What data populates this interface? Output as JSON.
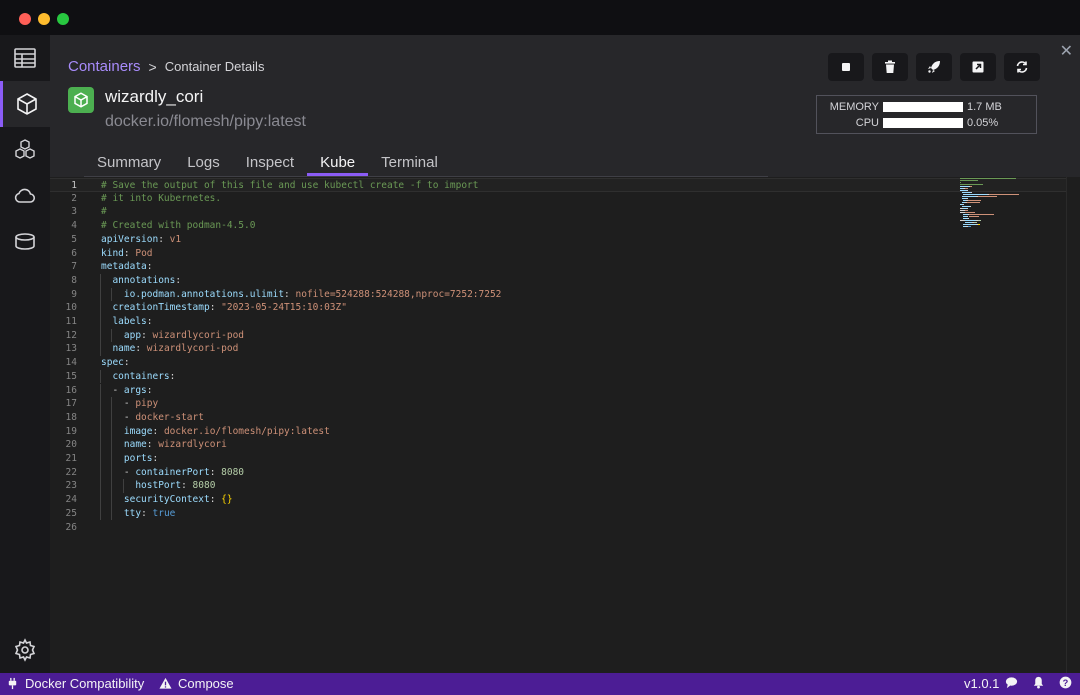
{
  "breadcrumb": {
    "parent": "Containers",
    "separator": ">",
    "current": "Container Details"
  },
  "container": {
    "name": "wizardly_cori",
    "image": "docker.io/flomesh/pipy:latest"
  },
  "actions": [
    {
      "id": "stop",
      "icon": "stop-icon"
    },
    {
      "id": "delete",
      "icon": "trash-icon"
    },
    {
      "id": "deploy",
      "icon": "rocket-icon"
    },
    {
      "id": "open-browser",
      "icon": "external-link-icon"
    },
    {
      "id": "restart",
      "icon": "refresh-icon"
    }
  ],
  "stats": {
    "memory": {
      "label": "MEMORY",
      "value": "1.7 MB",
      "fill": 0.98
    },
    "cpu": {
      "label": "CPU",
      "value": "0.05%",
      "fill": 0.98
    }
  },
  "tabs": [
    "Summary",
    "Logs",
    "Inspect",
    "Kube",
    "Terminal"
  ],
  "active_tab": "Kube",
  "editor": {
    "current_line": 1,
    "lines": [
      [
        [
          "c-com",
          "# Save the output of this file and use kubectl create -f to import"
        ]
      ],
      [
        [
          "c-com",
          "# it into Kubernetes."
        ]
      ],
      [
        [
          "c-com",
          "#"
        ]
      ],
      [
        [
          "c-com",
          "# Created with podman-4.5.0"
        ]
      ],
      [
        [
          "c-key",
          "apiVersion"
        ],
        [
          "c-pun",
          ": "
        ],
        [
          "c-str",
          "v1"
        ]
      ],
      [
        [
          "c-key",
          "kind"
        ],
        [
          "c-pun",
          ": "
        ],
        [
          "c-str",
          "Pod"
        ]
      ],
      [
        [
          "c-key",
          "metadata"
        ],
        [
          "c-pun",
          ":"
        ]
      ],
      [
        [
          "c-pun",
          "  "
        ],
        [
          "c-key",
          "annotations"
        ],
        [
          "c-pun",
          ":"
        ]
      ],
      [
        [
          "c-pun",
          "    "
        ],
        [
          "c-key",
          "io.podman.annotations.ulimit"
        ],
        [
          "c-pun",
          ": "
        ],
        [
          "c-str",
          "nofile=524288:524288,nproc=7252:7252"
        ]
      ],
      [
        [
          "c-pun",
          "  "
        ],
        [
          "c-key",
          "creationTimestamp"
        ],
        [
          "c-pun",
          ": "
        ],
        [
          "c-str",
          "\"2023-05-24T15:10:03Z\""
        ]
      ],
      [
        [
          "c-pun",
          "  "
        ],
        [
          "c-key",
          "labels"
        ],
        [
          "c-pun",
          ":"
        ]
      ],
      [
        [
          "c-pun",
          "    "
        ],
        [
          "c-key",
          "app"
        ],
        [
          "c-pun",
          ": "
        ],
        [
          "c-str",
          "wizardlycori-pod"
        ]
      ],
      [
        [
          "c-pun",
          "  "
        ],
        [
          "c-key",
          "name"
        ],
        [
          "c-pun",
          ": "
        ],
        [
          "c-str",
          "wizardlycori-pod"
        ]
      ],
      [
        [
          "c-key",
          "spec"
        ],
        [
          "c-pun",
          ":"
        ]
      ],
      [
        [
          "c-pun",
          "  "
        ],
        [
          "c-key",
          "containers"
        ],
        [
          "c-pun",
          ":"
        ]
      ],
      [
        [
          "c-pun",
          "  - "
        ],
        [
          "c-key",
          "args"
        ],
        [
          "c-pun",
          ":"
        ]
      ],
      [
        [
          "c-pun",
          "    - "
        ],
        [
          "c-str",
          "pipy"
        ]
      ],
      [
        [
          "c-pun",
          "    - "
        ],
        [
          "c-str",
          "docker-start"
        ]
      ],
      [
        [
          "c-pun",
          "    "
        ],
        [
          "c-key",
          "image"
        ],
        [
          "c-pun",
          ": "
        ],
        [
          "c-str",
          "docker.io/flomesh/pipy:latest"
        ]
      ],
      [
        [
          "c-pun",
          "    "
        ],
        [
          "c-key",
          "name"
        ],
        [
          "c-pun",
          ": "
        ],
        [
          "c-str",
          "wizardlycori"
        ]
      ],
      [
        [
          "c-pun",
          "    "
        ],
        [
          "c-key",
          "ports"
        ],
        [
          "c-pun",
          ":"
        ]
      ],
      [
        [
          "c-pun",
          "    - "
        ],
        [
          "c-key",
          "containerPort"
        ],
        [
          "c-pun",
          ": "
        ],
        [
          "c-num",
          "8080"
        ]
      ],
      [
        [
          "c-pun",
          "      "
        ],
        [
          "c-key",
          "hostPort"
        ],
        [
          "c-pun",
          ": "
        ],
        [
          "c-num",
          "8080"
        ]
      ],
      [
        [
          "c-pun",
          "    "
        ],
        [
          "c-key",
          "securityContext"
        ],
        [
          "c-pun",
          ": "
        ],
        [
          "c-brk",
          "{}"
        ]
      ],
      [
        [
          "c-pun",
          "    "
        ],
        [
          "c-key",
          "tty"
        ],
        [
          "c-pun",
          ": "
        ],
        [
          "c-kw",
          "true"
        ]
      ],
      []
    ],
    "indent_guides": [
      [],
      [],
      [],
      [],
      [],
      [],
      [],
      [
        1
      ],
      [
        1,
        2
      ],
      [
        1
      ],
      [
        1
      ],
      [
        1,
        2
      ],
      [
        1
      ],
      [],
      [
        1
      ],
      [
        1
      ],
      [
        1,
        2
      ],
      [
        1,
        2
      ],
      [
        1,
        2
      ],
      [
        1,
        2
      ],
      [
        1,
        2
      ],
      [
        1,
        2
      ],
      [
        1,
        2,
        3
      ],
      [
        1,
        2
      ],
      [
        1,
        2
      ],
      []
    ]
  },
  "statusbar": {
    "docker": "Docker Compatibility",
    "compose": "Compose",
    "version": "v1.0.1"
  }
}
